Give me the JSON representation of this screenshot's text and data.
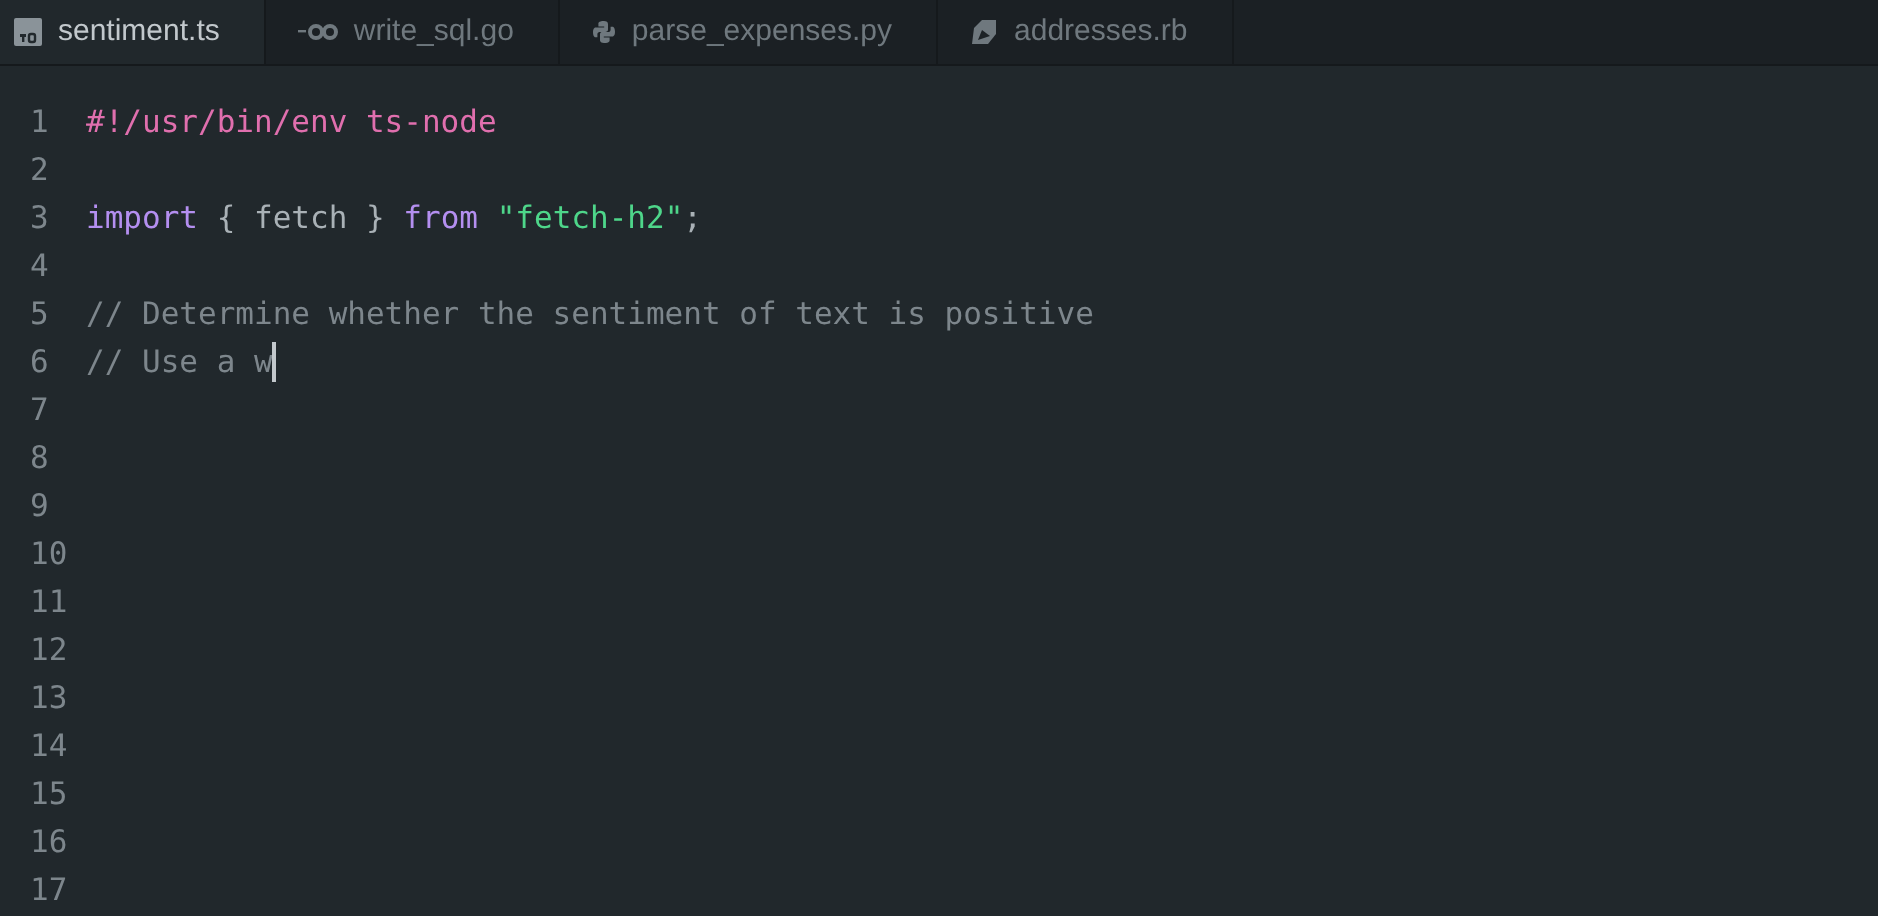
{
  "tabs": [
    {
      "label": "sentiment.ts",
      "kind": "ts",
      "selected": true
    },
    {
      "label": "write_sql.go",
      "kind": "go",
      "selected": false
    },
    {
      "label": "parse_expenses.py",
      "kind": "py",
      "selected": false
    },
    {
      "label": "addresses.rb",
      "kind": "rb",
      "selected": false
    }
  ],
  "editor": {
    "lines": [
      {
        "number": "1",
        "tokens": [
          {
            "text": "#!/usr/bin/env ts-node",
            "kind": "shebang"
          }
        ]
      },
      {
        "number": "2"
      },
      {
        "number": "3",
        "tokens": [
          {
            "text": "import",
            "kind": "keyword"
          },
          {
            "text": " { fetch } ",
            "kind": "plain"
          },
          {
            "text": "from ",
            "kind": "keyword"
          },
          {
            "text": "\"fetch-h2\"",
            "kind": "string"
          },
          {
            "text": ";",
            "kind": "plain"
          }
        ]
      },
      {
        "number": "4"
      },
      {
        "number": "5",
        "tokens": [
          {
            "text": "// Determine whether the sentiment of text is positive",
            "kind": "comment"
          }
        ]
      },
      {
        "number": "6",
        "tokens": [
          {
            "text": "// Use a w",
            "kind": "comment"
          }
        ],
        "cursor": true
      },
      {
        "number": "7"
      },
      {
        "number": "8"
      },
      {
        "number": "9"
      },
      {
        "number": "10"
      },
      {
        "number": "11"
      },
      {
        "number": "12"
      },
      {
        "number": "13"
      },
      {
        "number": "14"
      },
      {
        "number": "15"
      },
      {
        "number": "16"
      },
      {
        "number": "17"
      }
    ]
  }
}
